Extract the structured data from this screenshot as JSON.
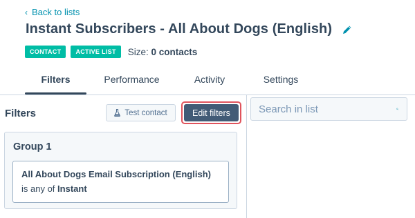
{
  "nav": {
    "back_label": "Back to lists"
  },
  "header": {
    "title": "Instant Subscribers - All About Dogs (English)",
    "tags": [
      "CONTACT",
      "ACTIVE LIST"
    ],
    "size_label": "Size:",
    "size_value": "0 contacts"
  },
  "tabs": [
    {
      "label": "Filters",
      "active": true
    },
    {
      "label": "Performance",
      "active": false
    },
    {
      "label": "Activity",
      "active": false
    },
    {
      "label": "Settings",
      "active": false
    }
  ],
  "filters_panel": {
    "heading": "Filters",
    "test_contact_label": "Test contact",
    "edit_filters_label": "Edit filters",
    "group": {
      "title": "Group 1",
      "filter_property": "All About Dogs Email Subscription (English)",
      "filter_operator": "is any of",
      "filter_value": "Instant"
    }
  },
  "search": {
    "placeholder": "Search in list",
    "value": ""
  },
  "colors": {
    "link": "#0091ae",
    "tag_bg": "#00bda5",
    "primary_button": "#425b76",
    "highlight": "#e0535c",
    "text": "#33475b",
    "border": "#cbd6e2"
  },
  "icons": {
    "back": "chevron-left-icon",
    "edit": "pencil-icon",
    "test_contact": "flask-icon",
    "search": "magnifier-icon"
  }
}
